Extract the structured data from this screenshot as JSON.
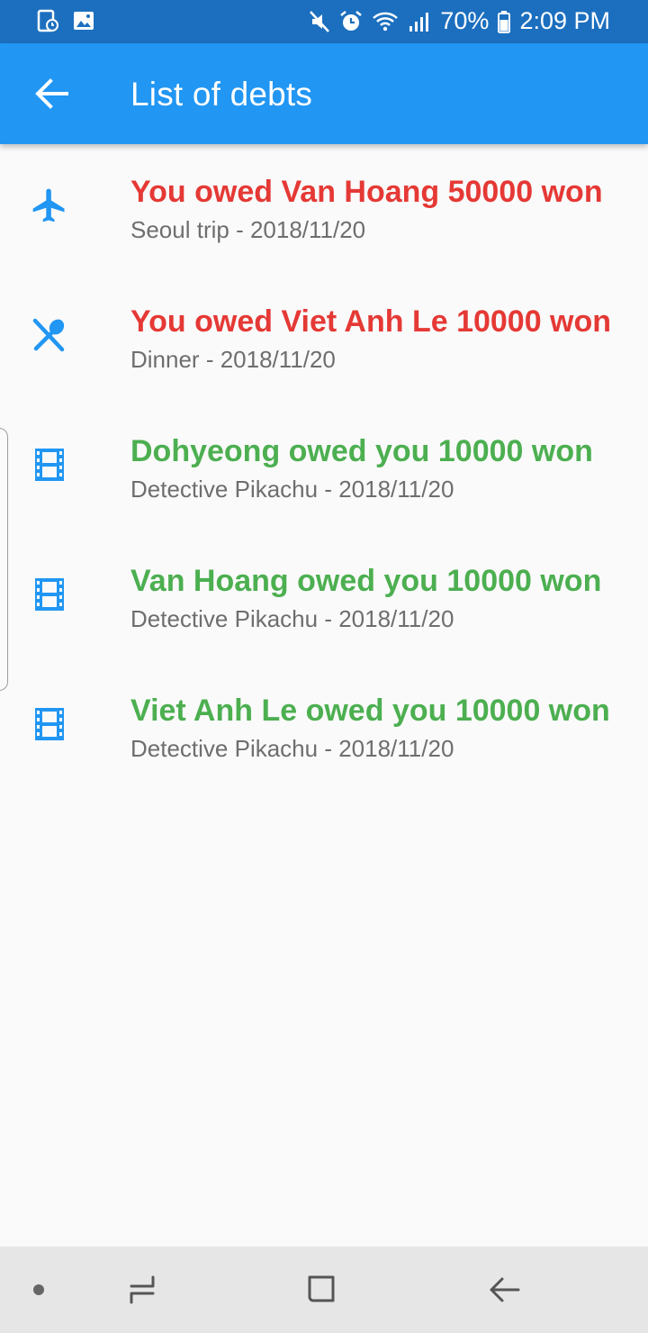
{
  "status_bar": {
    "battery": "70%",
    "time": "2:09 PM"
  },
  "app_bar": {
    "title": "List of debts"
  },
  "debts": [
    {
      "icon": "airplane-icon",
      "title": "You owed Van Hoang 50000 won",
      "subtitle": "Seoul trip - 2018/11/20",
      "color": "#e53935"
    },
    {
      "icon": "restaurant-icon",
      "title": "You owed Viet Anh Le 10000 won",
      "subtitle": "Dinner - 2018/11/20",
      "color": "#e53935"
    },
    {
      "icon": "movie-icon",
      "title": "Dohyeong owed you 10000 won",
      "subtitle": "Detective Pikachu - 2018/11/20",
      "color": "#4caf50"
    },
    {
      "icon": "movie-icon",
      "title": "Van Hoang owed you 10000 won",
      "subtitle": "Detective Pikachu - 2018/11/20",
      "color": "#4caf50"
    },
    {
      "icon": "movie-icon",
      "title": "Viet Anh Le owed you 10000 won",
      "subtitle": "Detective Pikachu - 2018/11/20",
      "color": "#4caf50"
    }
  ],
  "colors": {
    "app_bar": "#2196f3",
    "status_bar": "#1c6fbf",
    "icon": "#2196f3",
    "owed_by_you": "#e53935",
    "owed_to_you": "#4caf50"
  }
}
